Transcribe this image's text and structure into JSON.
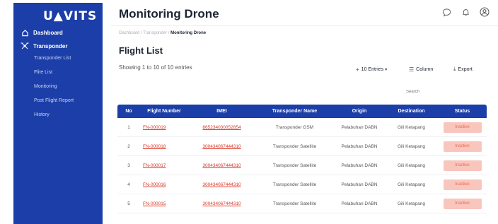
{
  "brand": {
    "logo": "U▲VITS"
  },
  "sidebar": {
    "items": [
      {
        "label": "Dashboard"
      },
      {
        "label": "Transponder"
      }
    ],
    "sub_items": [
      {
        "label": "Transponder List"
      },
      {
        "label": "Flite List"
      },
      {
        "label": "Monitoring"
      },
      {
        "label": "Post Flight Report"
      },
      {
        "label": "History"
      }
    ]
  },
  "header": {
    "title": "Monitoring Drone"
  },
  "breadcrumb": {
    "part1": "Dashboard",
    "sep": "/",
    "part2": "Transponder",
    "current": "Monitoring Drone"
  },
  "main": {
    "title": "Flight List",
    "showing": "Showing 1 to 10 of 10 entries",
    "entries_label": "10 Entries",
    "column_label": "Column",
    "export_label": "Export",
    "search_placeholder": "Search"
  },
  "table": {
    "headers": [
      "No",
      "Flight Number",
      "IMEI",
      "Transponder Name",
      "Origin",
      "Destination",
      "Status"
    ],
    "rows": [
      {
        "no": "1",
        "flight": "FN-000019",
        "imei": "865234030052854",
        "name": "Transponder GSM",
        "origin": "Pelabuhan DABN",
        "dest": "Gili Ketapang",
        "status": "Inactive"
      },
      {
        "no": "2",
        "flight": "FN-000018",
        "imei": "300434067444310",
        "name": "Transponder Satellite",
        "origin": "Pelabuhan DABN",
        "dest": "Gili Ketapang",
        "status": "Inactive"
      },
      {
        "no": "3",
        "flight": "FN-000017",
        "imei": "300434067444310",
        "name": "Transponder Satellite",
        "origin": "Pelabuhan DABN",
        "dest": "Gili Ketapang",
        "status": "Inactive"
      },
      {
        "no": "4",
        "flight": "FN-000016",
        "imei": "300434067444310",
        "name": "Transponder Satellite",
        "origin": "Pelabuhan DABN",
        "dest": "Gili Ketapang",
        "status": "Inactive"
      },
      {
        "no": "5",
        "flight": "FN-000015",
        "imei": "300434067444310",
        "name": "Transponder Satellite",
        "origin": "Pelabuhan DABN",
        "dest": "Gili Ketapang",
        "status": "Inactive"
      }
    ]
  },
  "colors": {
    "primary": "#1c3ea8",
    "link": "#d93a2b",
    "badge_bg": "#f9c6bd",
    "badge_text": "#ea6b55"
  },
  "icons": [
    "home-icon",
    "drone-icon",
    "chat-icon",
    "bell-icon",
    "user-icon",
    "plus-icon",
    "column-icon",
    "export-icon",
    "search-icon"
  ]
}
